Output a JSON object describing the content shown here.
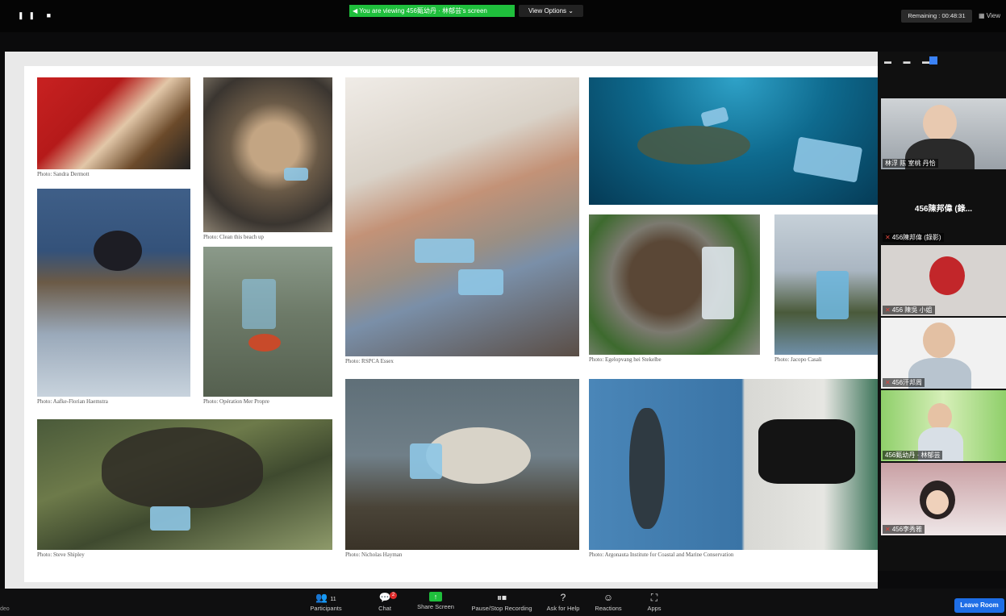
{
  "top": {
    "viewing_banner": "◀ You are viewing 456甄幼丹 · 林郁芸's screen",
    "view_options": "View Options ⌄",
    "remaining": "Remaining : 00:48:31",
    "view": "▦ View"
  },
  "captions": {
    "c1": "Photo: Sandra Dermott",
    "c2": "Photo: Clean this beach up",
    "c3": "Photo: RSPCA Essex",
    "c5": "Photo: Aafke-Florian Haemstra",
    "c6": "Photo: Opération Mer Propre",
    "c7": "Photo: Egelopvang hei Stekelbe",
    "c8": "Photo: Jacopo Casali",
    "c9": "Photo: Steve Shipley",
    "c10": "Photo: Nicholas Hayman",
    "c11": "Photo: Argonauta Institute for Coastal and Marine Conservation"
  },
  "gallery": {
    "p1": "林浮 陈 室桃 丹恰",
    "p2_big": "456陳邦偉 (錄...",
    "p2": "456陳邦偉 (錄影)",
    "p3": "456 陳吳 小姐",
    "p4": "456汗邦周",
    "p5": "456甄幼丹 · 林郁芸",
    "p6": "456李秀雅"
  },
  "toolbar": {
    "participants": "Participants",
    "participants_count": "11",
    "chat": "Chat",
    "chat_badge": "2",
    "share": "Share Screen",
    "record": "Pause/Stop Recording",
    "help": "Ask for Help",
    "reactions": "Reactions",
    "apps": "Apps",
    "leave": "Leave Room",
    "left_fragment": "deo"
  }
}
